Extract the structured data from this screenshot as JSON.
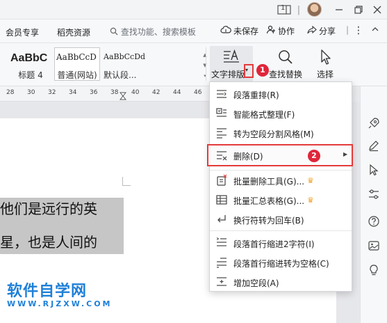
{
  "titlebar": {
    "page_icon_label": "1"
  },
  "menubar": {
    "items": [
      "会员专享",
      "稻壳资源"
    ],
    "search_placeholder": "查找功能、搜索模板",
    "unsaved_label": "未保存",
    "collab_label": "协作",
    "share_label": "分享"
  },
  "ribbon": {
    "styles": [
      {
        "sample": "AaBbC",
        "name": "标题 4"
      },
      {
        "sample": "AaBbCcD",
        "name": "普通(网站)"
      },
      {
        "sample": "AaBbCcDd",
        "name": "默认段..."
      }
    ],
    "text_layout_label": "文字排版",
    "find_replace_label": "查找替换",
    "select_label": "选择"
  },
  "ruler": {
    "numbers": [
      "28",
      "30",
      "32",
      "34",
      "36",
      "38",
      "40",
      "42",
      "44",
      "46"
    ]
  },
  "document": {
    "lines": [
      "他们是远行的英",
      "星，也是人间的"
    ],
    "watermark_cn": "软件自学网",
    "watermark_en": "WWW.RJZXW.COM"
  },
  "dropdown": {
    "items": [
      {
        "label": "段落重排(R)",
        "icon": "paragraph-rearrange-icon"
      },
      {
        "label": "智能格式整理(F)",
        "icon": "smart-format-icon"
      },
      {
        "label": "转为空段分割风格(M)",
        "icon": "empty-paragraph-split-icon"
      },
      {
        "label": "删除(D)",
        "icon": "delete-format-icon"
      },
      {
        "label": "批量删除工具(G)...",
        "icon": "batch-delete-icon"
      },
      {
        "label": "批量汇总表格(G)...",
        "icon": "batch-summary-table-icon"
      },
      {
        "label": "换行符转为回车(B)",
        "icon": "linebreak-to-enter-icon"
      },
      {
        "label": "段落首行缩进2字符(I)",
        "icon": "first-line-indent-icon"
      },
      {
        "label": "段落首行缩进转为空格(C)",
        "icon": "indent-to-space-icon"
      },
      {
        "label": "增加空段(A)",
        "icon": "add-empty-paragraph-icon"
      }
    ]
  },
  "badges": {
    "step1": "1",
    "step2": "2"
  },
  "colors": {
    "accent_red": "#e33b3b",
    "badge_red": "#e0263a",
    "watermark_blue": "#1f80d8",
    "crown": "#f0a22b"
  }
}
